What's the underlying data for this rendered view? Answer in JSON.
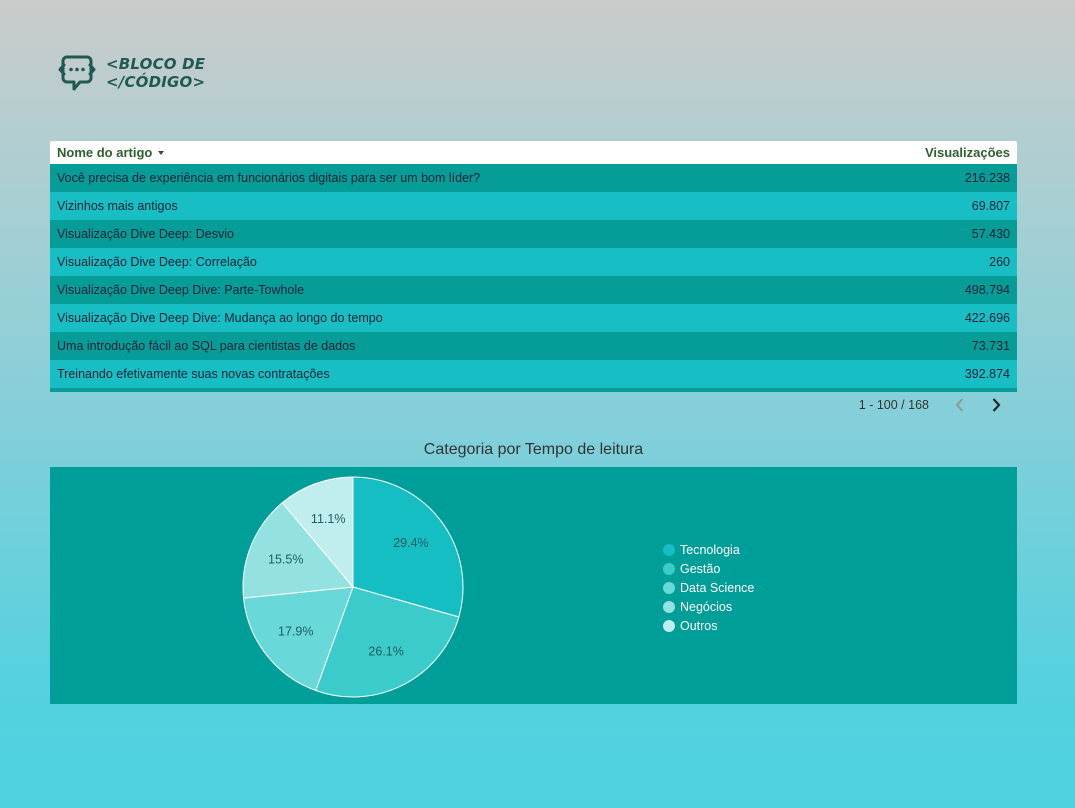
{
  "logo": {
    "line1": "<BLOCO DE",
    "line2": "</CÓDIGO>",
    "icon": "chat-code-icon",
    "color": "#1e5a52"
  },
  "table": {
    "headers": {
      "article": "Nome do artigo",
      "views": "Visualizações"
    },
    "rows": [
      {
        "article": "Você precisa de experiência em funcionários digitais para ser um bom líder?",
        "views": "216.238"
      },
      {
        "article": "Vizinhos mais antigos",
        "views": "69.807"
      },
      {
        "article": "Visualização Dive Deep: Desvio",
        "views": "57.430"
      },
      {
        "article": "Visualização Dive Deep: Correlação",
        "views": "260"
      },
      {
        "article": "Visualização Dive Deep Dive: Parte-Towhole",
        "views": "498.794"
      },
      {
        "article": "Visualização Dive Deep Dive: Mudança ao longo do tempo",
        "views": "422.696"
      },
      {
        "article": "Uma introdução fácil ao SQL para cientistas de dados",
        "views": "73.731"
      },
      {
        "article": "Treinando efetivamente suas novas contratações",
        "views": "392.874"
      }
    ]
  },
  "pager": {
    "text": "1 - 100 / 168",
    "prev_icon": "chevron-left-icon",
    "next_icon": "chevron-right-icon"
  },
  "chart_data": {
    "type": "pie",
    "title": "Categoria por Tempo de leitura",
    "categories": [
      "Tecnologia",
      "Gestão",
      "Data Science",
      "Negócios",
      "Outros"
    ],
    "values": [
      29.4,
      26.1,
      17.9,
      15.5,
      11.1
    ],
    "labels": [
      "29.4%",
      "26.1%",
      "17.9%",
      "15.5%",
      "11.1%"
    ],
    "colors": [
      "#14bec2",
      "#3ccbcb",
      "#68d8d8",
      "#93e2e1",
      "#c0eeee"
    ],
    "legend_position": "right"
  },
  "colors": {
    "row_dark": "#069c98",
    "row_light": "#17bfc4",
    "header_text": "#2e5f2f",
    "panel": "#009e98"
  }
}
